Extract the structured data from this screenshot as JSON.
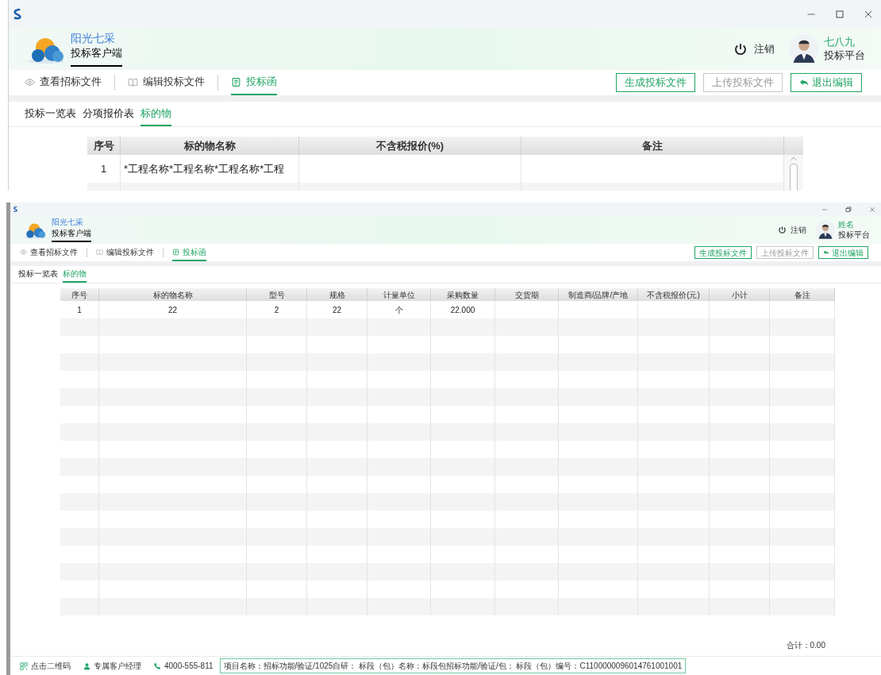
{
  "screens": [
    {
      "brand": {
        "name": "阳光七采",
        "subtitle": "投标客户端"
      },
      "logout": "注销",
      "user": {
        "name": "七八九",
        "role": "投标平台"
      },
      "nav_tabs": [
        {
          "label": "查看招标文件",
          "kind": "eye",
          "selected": false
        },
        {
          "label": "编辑投标文件",
          "kind": "book",
          "selected": false
        },
        {
          "label": "投标函",
          "kind": "doc",
          "selected": true
        }
      ],
      "actions": [
        {
          "label": "生成投标文件",
          "kind": "plain",
          "disabled": false
        },
        {
          "label": "上传投标文件",
          "kind": "plain",
          "disabled": true
        },
        {
          "label": "退出编辑",
          "kind": "back",
          "disabled": false
        }
      ],
      "sub_tabs": [
        {
          "label": "投标一览表",
          "selected": false
        },
        {
          "label": "分项报价表",
          "selected": false
        },
        {
          "label": "标的物",
          "selected": true
        }
      ],
      "table": {
        "columns": [
          "序号",
          "标的物名称",
          "不含税报价(%)",
          "备注"
        ],
        "rows": [
          {
            "cells": [
              "1",
              "*工程名称*工程名称*工程名称*工程"
            ]
          }
        ]
      }
    },
    {
      "brand": {
        "name": "阳光七采",
        "subtitle": "投标客户端"
      },
      "logout": "注销",
      "user": {
        "name": "姓名",
        "role": "投标平台"
      },
      "nav_tabs": [
        {
          "label": "查看招标文件",
          "kind": "eye",
          "selected": false
        },
        {
          "label": "编辑投标文件",
          "kind": "book",
          "selected": false
        },
        {
          "label": "投标函",
          "kind": "doc",
          "selected": true
        }
      ],
      "actions": [
        {
          "label": "生成投标文件",
          "kind": "plain",
          "disabled": false
        },
        {
          "label": "上传投标文件",
          "kind": "plain",
          "disabled": true
        },
        {
          "label": "退出编辑",
          "kind": "back",
          "disabled": false
        }
      ],
      "sub_tabs": [
        {
          "label": "投标一览表",
          "selected": false
        },
        {
          "label": "标的物",
          "selected": true
        }
      ],
      "table": {
        "columns": [
          "序号",
          "标的物名称",
          "型号",
          "规格",
          "计量单位",
          "采购数量",
          "交货期",
          "制造商/品牌/产地",
          "不含税报价(元)",
          "小计",
          "备注"
        ],
        "rows": [
          {
            "cells": [
              "1",
              "22",
              "2",
              "22",
              "个",
              "22.000"
            ]
          }
        ]
      },
      "total": "合计：0.00",
      "status_bar": {
        "qr": "点击二维码",
        "manager": "专属客户经理",
        "phone": "4000-555-811",
        "project": "项目名称：招标功能/验证/1025自研： 标段（包）名称：标段包招标功能/验证/包： 标段（包）编号：C1100000096014761001001"
      }
    }
  ]
}
